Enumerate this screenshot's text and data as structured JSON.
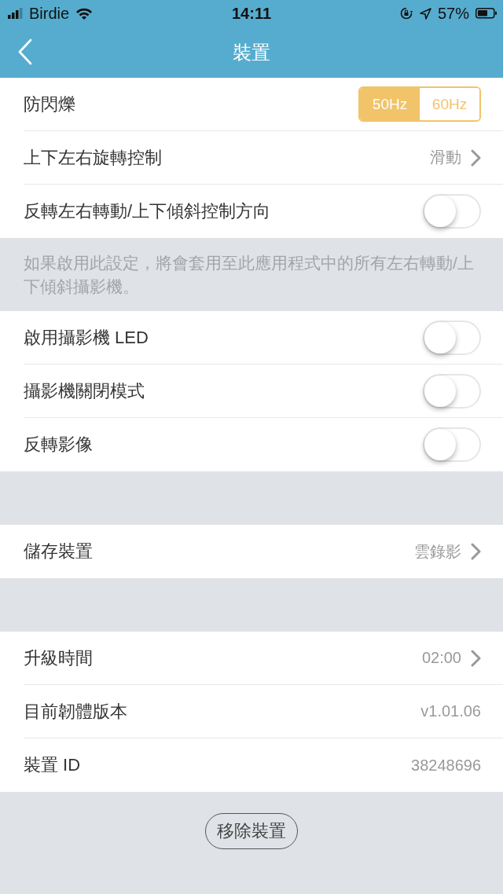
{
  "status_bar": {
    "carrier": "Birdie",
    "time": "14:11",
    "battery": "57%"
  },
  "nav": {
    "title": "裝置"
  },
  "sections": [
    {
      "kind": "group",
      "rows": [
        {
          "kind": "segmented",
          "label": "防閃爍",
          "options": [
            {
              "label": "50Hz",
              "selected": true
            },
            {
              "label": "60Hz",
              "selected": false
            }
          ]
        },
        {
          "kind": "link",
          "label": "上下左右旋轉控制",
          "value": "滑動"
        },
        {
          "kind": "toggle",
          "label": "反轉左右轉動/上下傾斜控制方向",
          "on": false
        }
      ]
    },
    {
      "kind": "note",
      "text": "如果啟用此設定，將會套用至此應用程式中的所有左右轉動/上下傾斜攝影機。"
    },
    {
      "kind": "group",
      "rows": [
        {
          "kind": "toggle",
          "label": "啟用攝影機 LED",
          "on": false
        },
        {
          "kind": "toggle",
          "label": "攝影機關閉模式",
          "on": false
        },
        {
          "kind": "toggle",
          "label": "反轉影像",
          "on": false
        }
      ]
    },
    {
      "kind": "spacer"
    },
    {
      "kind": "group",
      "rows": [
        {
          "kind": "link",
          "label": "儲存裝置",
          "value": "雲錄影"
        }
      ]
    },
    {
      "kind": "spacer"
    },
    {
      "kind": "group",
      "rows": [
        {
          "kind": "link",
          "label": "升級時間",
          "value": "02:00"
        },
        {
          "kind": "value",
          "label": "目前韌體版本",
          "value": "v1.01.06"
        },
        {
          "kind": "value",
          "label": "裝置 ID",
          "value": "38248696"
        }
      ]
    }
  ],
  "remove_button": "移除裝置"
}
